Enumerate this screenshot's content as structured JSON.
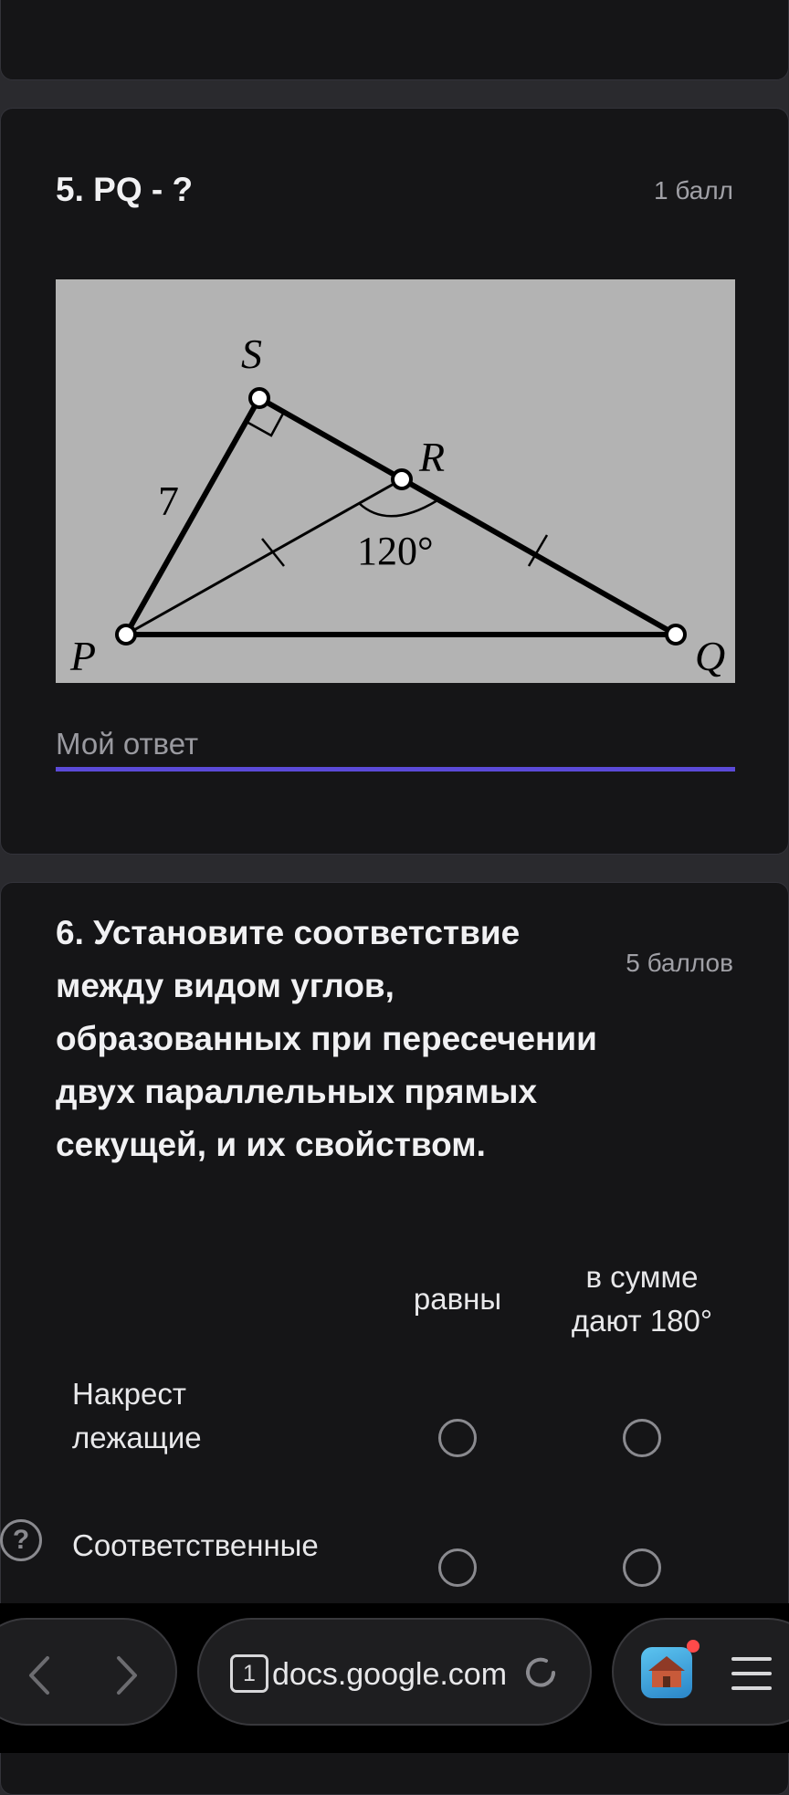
{
  "question5": {
    "title": "5.  PQ - ?",
    "points": "1 балл",
    "figure": {
      "labels": {
        "S": "S",
        "R": "R",
        "P": "P",
        "Q": "Q",
        "side": "7",
        "angle": "120°"
      }
    },
    "answer_placeholder": "Мой ответ",
    "answer_value": ""
  },
  "question6": {
    "title_lines": [
      "6. Установите соответствие",
      "между видом углов,",
      "образованных при пересечении",
      "двух параллельных прямых",
      "секущей, и их свойством."
    ],
    "points": "5 баллов",
    "columns": [
      {
        "lines": [
          "равны"
        ]
      },
      {
        "lines": [
          "в сумме",
          "дают 180°"
        ]
      }
    ],
    "rows": [
      {
        "lines": [
          "Накрест",
          "лежащие"
        ]
      },
      {
        "lines": [
          "Соответственные"
        ]
      }
    ]
  },
  "help_label": "?",
  "browser": {
    "tab_count": "1",
    "url": "docs.google.com",
    "icons": [
      "back-icon",
      "forward-icon",
      "tabs-icon",
      "reload-icon",
      "game-app-icon",
      "menu-icon"
    ],
    "accent_color": "#5b4ad8"
  }
}
